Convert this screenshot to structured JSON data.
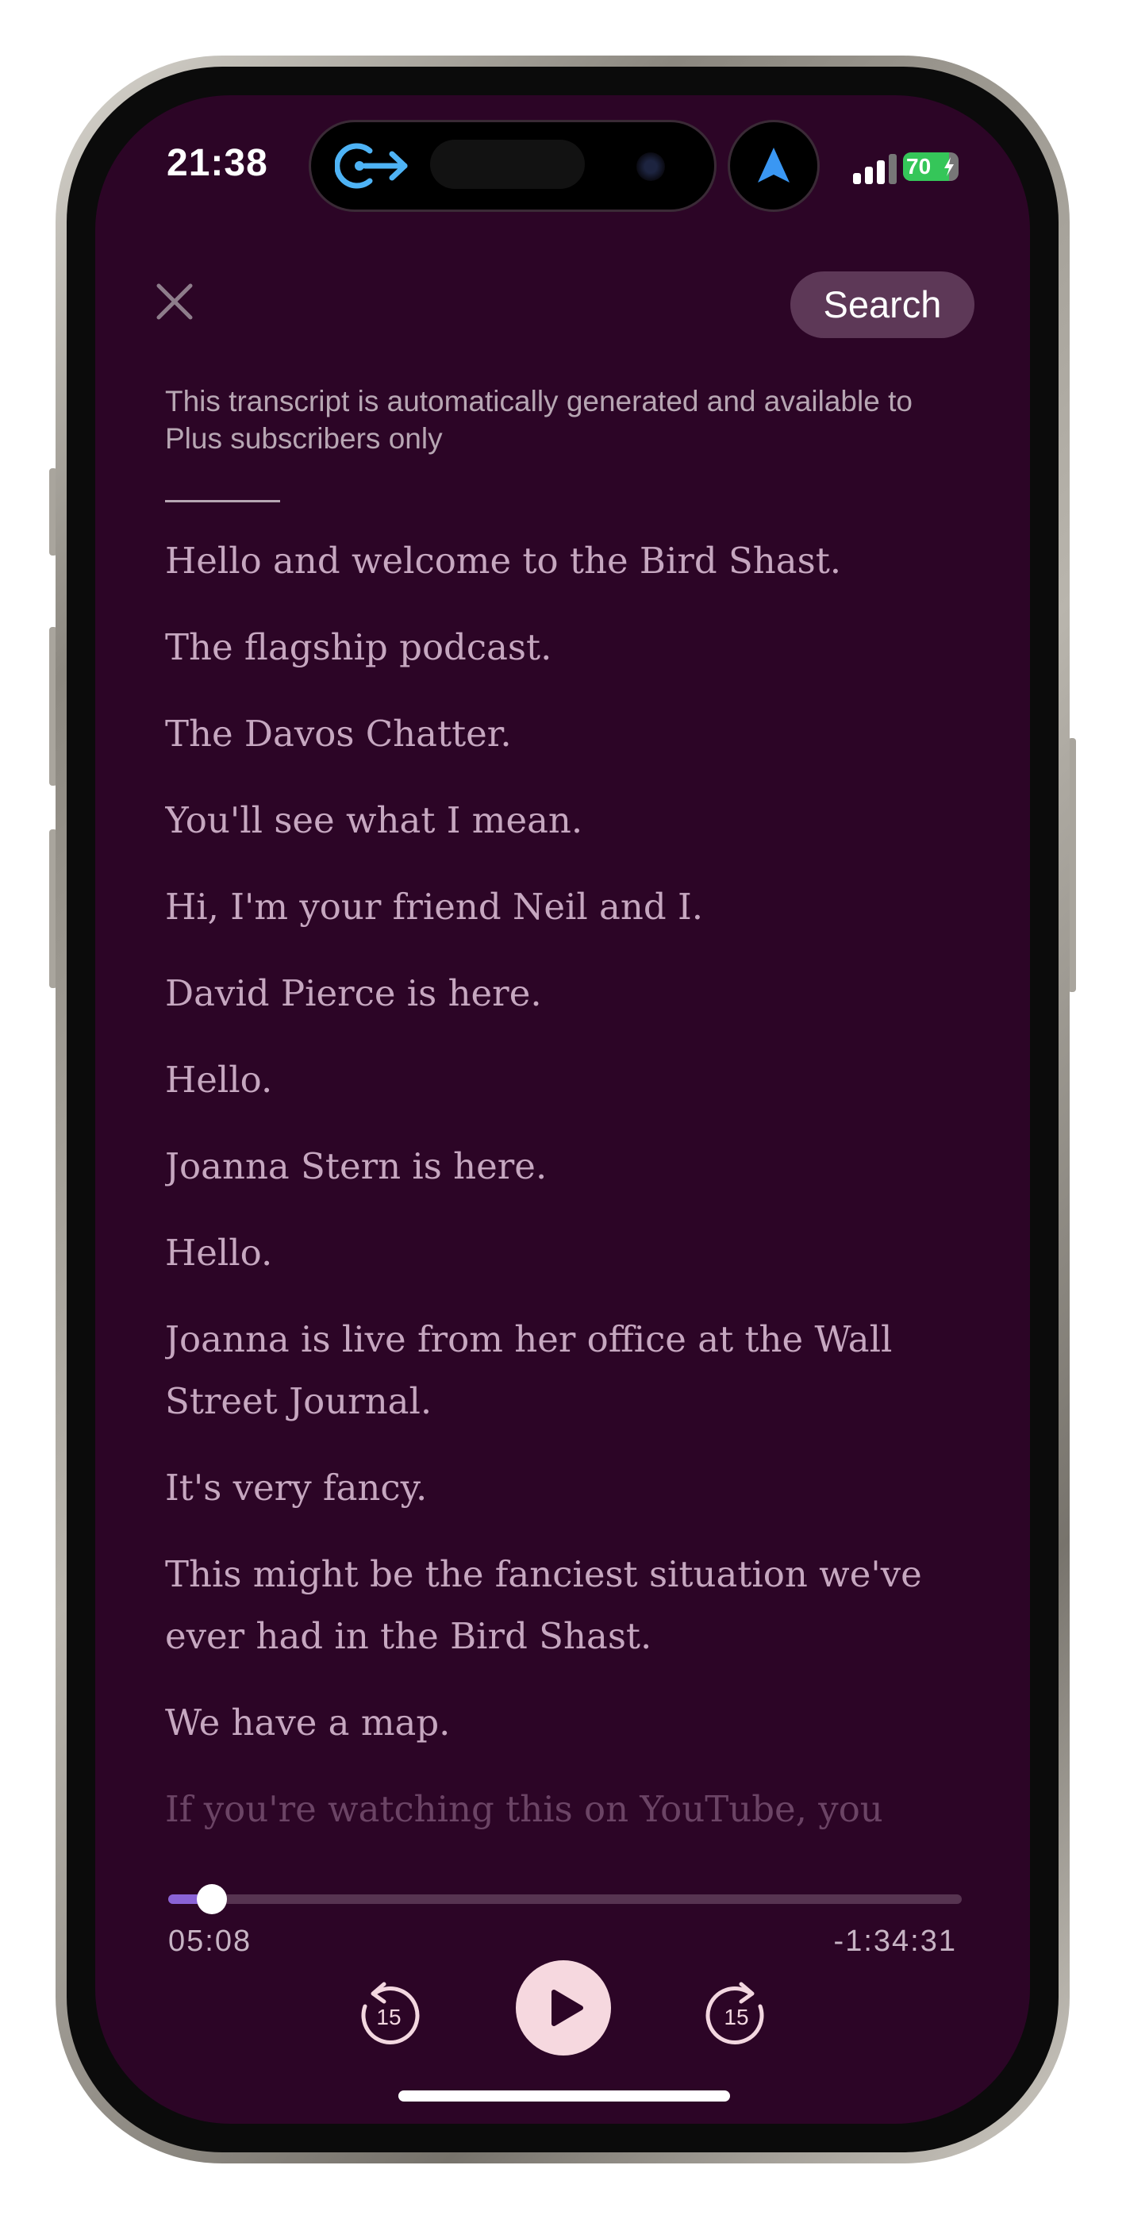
{
  "status_bar": {
    "time": "21:38",
    "battery": "70"
  },
  "header": {
    "close_icon": "close-icon",
    "search_label": "Search"
  },
  "notice": "This transcript is automatically generated and available to Plus subscribers only",
  "transcript": [
    "Hello and welcome to the Bird Shast.",
    "The flagship podcast.",
    "The Davos Chatter.",
    "You'll see what I mean.",
    "Hi, I'm your friend Neil and I.",
    "David Pierce is here.",
    "Hello.",
    "Joanna Stern is here.",
    "Hello.",
    "Joanna is live from her office at the Wall Street Journal.",
    "It's very fancy.",
    "This might be the fanciest situation we've ever had in the Bird Shast.",
    "We have a map.",
    "If you're watching this on YouTube, you"
  ],
  "player": {
    "elapsed": "05:08",
    "remaining": "-1:34:31",
    "progress": 0.055,
    "skip_back_label": "15",
    "skip_forward_label": "15"
  },
  "colors": {
    "background": "#2c0526",
    "text": "#c6a7c0",
    "accent": "#8a63d6",
    "play_button": "#f6d8df",
    "search_pill": "#5d3857"
  }
}
